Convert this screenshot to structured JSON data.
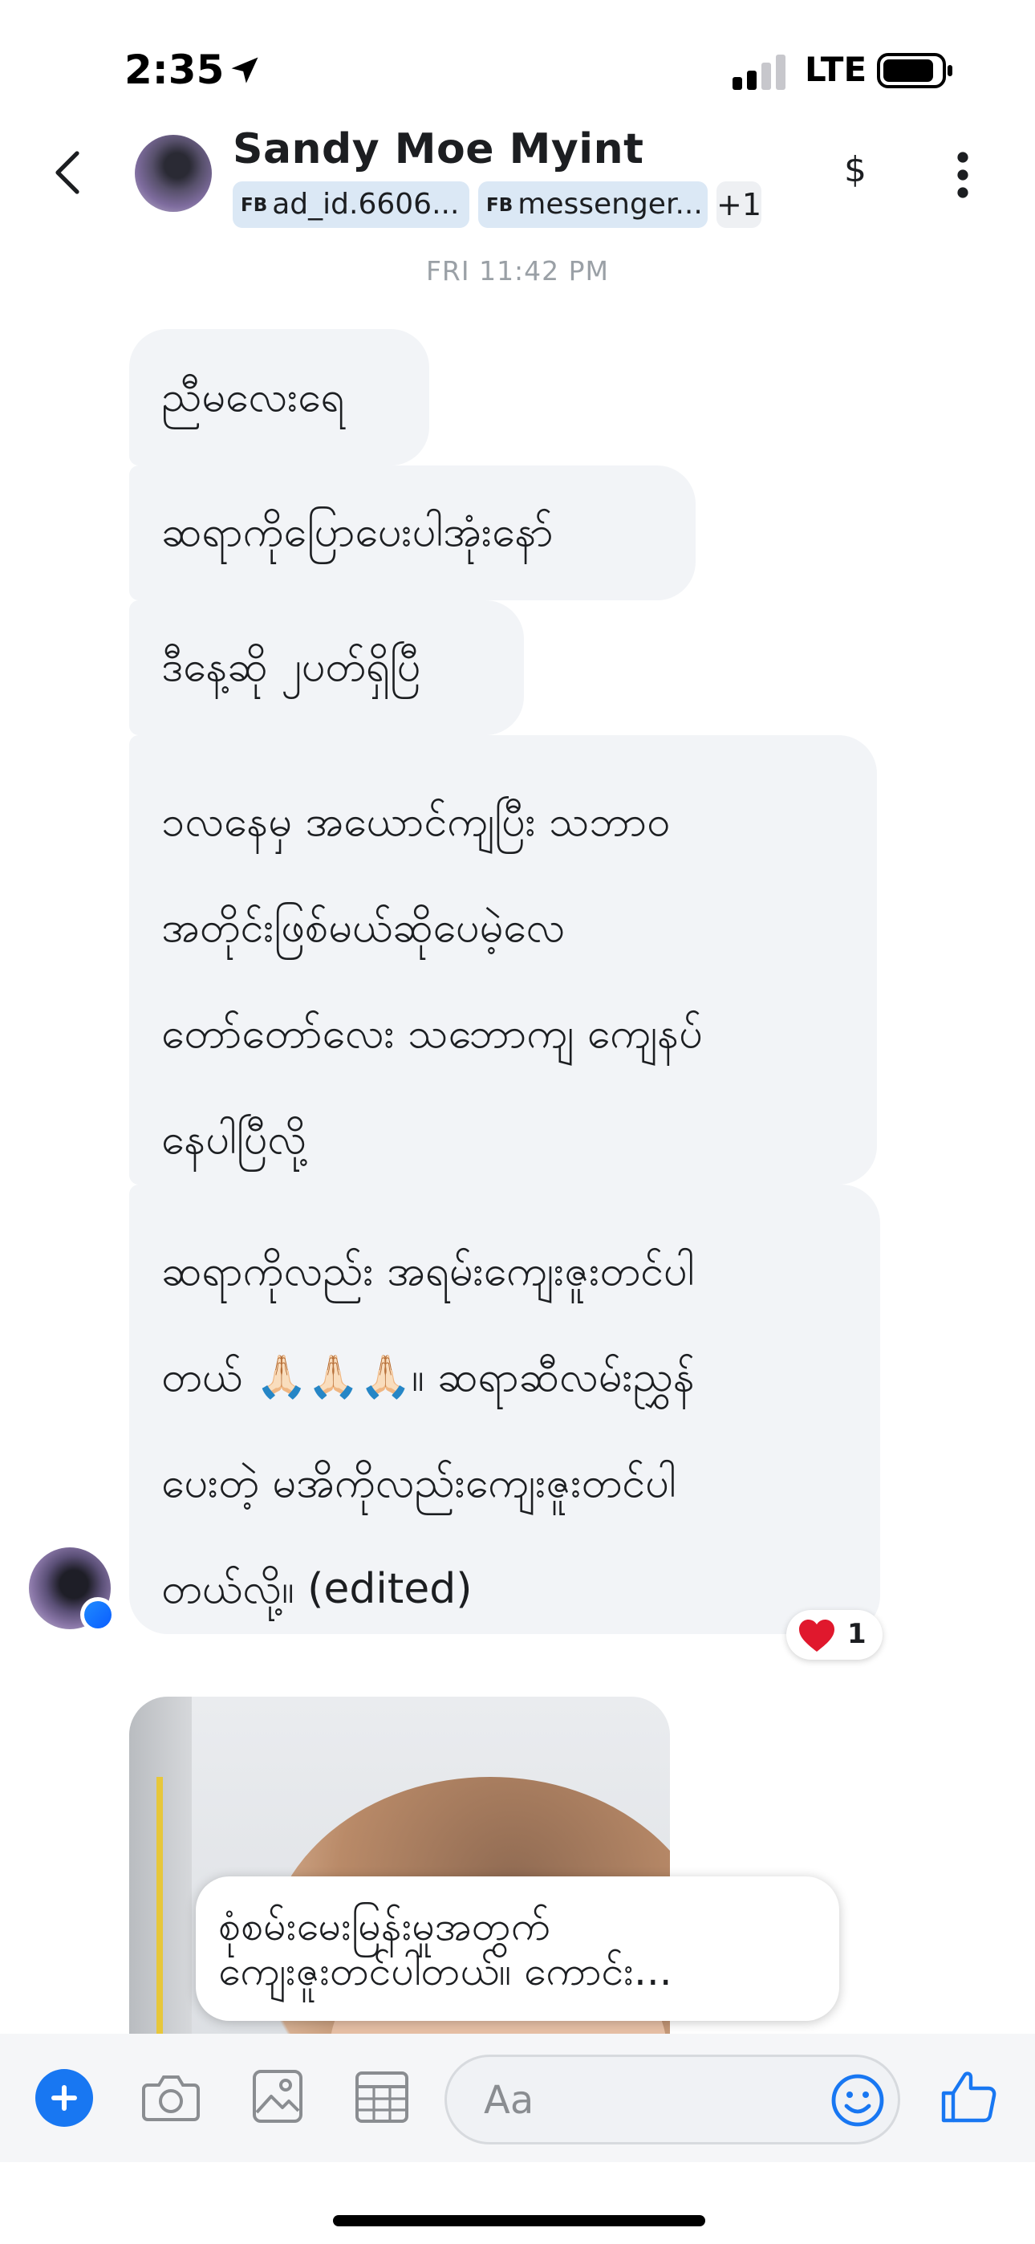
{
  "status_bar": {
    "time": "2:35",
    "network": "LTE"
  },
  "header": {
    "contact_name": "Sandy Moe Myint",
    "tags": [
      {
        "prefix": "FB",
        "label": "ad_id.6606..."
      },
      {
        "prefix": "FB",
        "label": "messenger..."
      }
    ],
    "more_tags": "+1",
    "payment_symbol": "$"
  },
  "timestamp": "FRI 11:42 PM",
  "messages": [
    {
      "lines": [
        "ညီမလေးရေ"
      ]
    },
    {
      "lines": [
        "ဆရာကိုပြောပေးပါအုံးနော်"
      ]
    },
    {
      "lines": [
        "ဒီနေ့ဆို ၂ပတ်ရှိပြီ"
      ]
    },
    {
      "lines": [
        "၁လနေမှ အယောင်ကျပြီး သဘာဝ",
        "အတိုင်းဖြစ်မယ်ဆိုပေမဲ့လေ",
        "တော်တော်လေး သဘောကျ ကျေနပ်",
        "နေပါပြီလို့"
      ]
    },
    {
      "lines": [
        "ဆရာကိုလည်း အရမ်းကျေးဇူးတင်ပါ",
        "တယ် 🙏🏻🙏🏻🙏🏻။ ဆရာဆီလမ်းညွှန်",
        "ပေးတဲ့ မအိကိုလည်းကျေးဇူးတင်ပါ",
        "တယ်လို့။ (edited)"
      ]
    }
  ],
  "reaction": {
    "emoji": "heart",
    "count": "1"
  },
  "photo_caption": {
    "lines": [
      "စုံစမ်းမေးမြန်းမှုအတွက်",
      "ကျေးဇူးတင်ပါတယ်။ ကောင်း..."
    ]
  },
  "composer": {
    "placeholder": "Aa"
  },
  "colors": {
    "accent": "#1877f2",
    "bubble": "#f2f4f7",
    "tag_chip": "#dbe8f5",
    "reaction_heart": "#e0182d"
  }
}
